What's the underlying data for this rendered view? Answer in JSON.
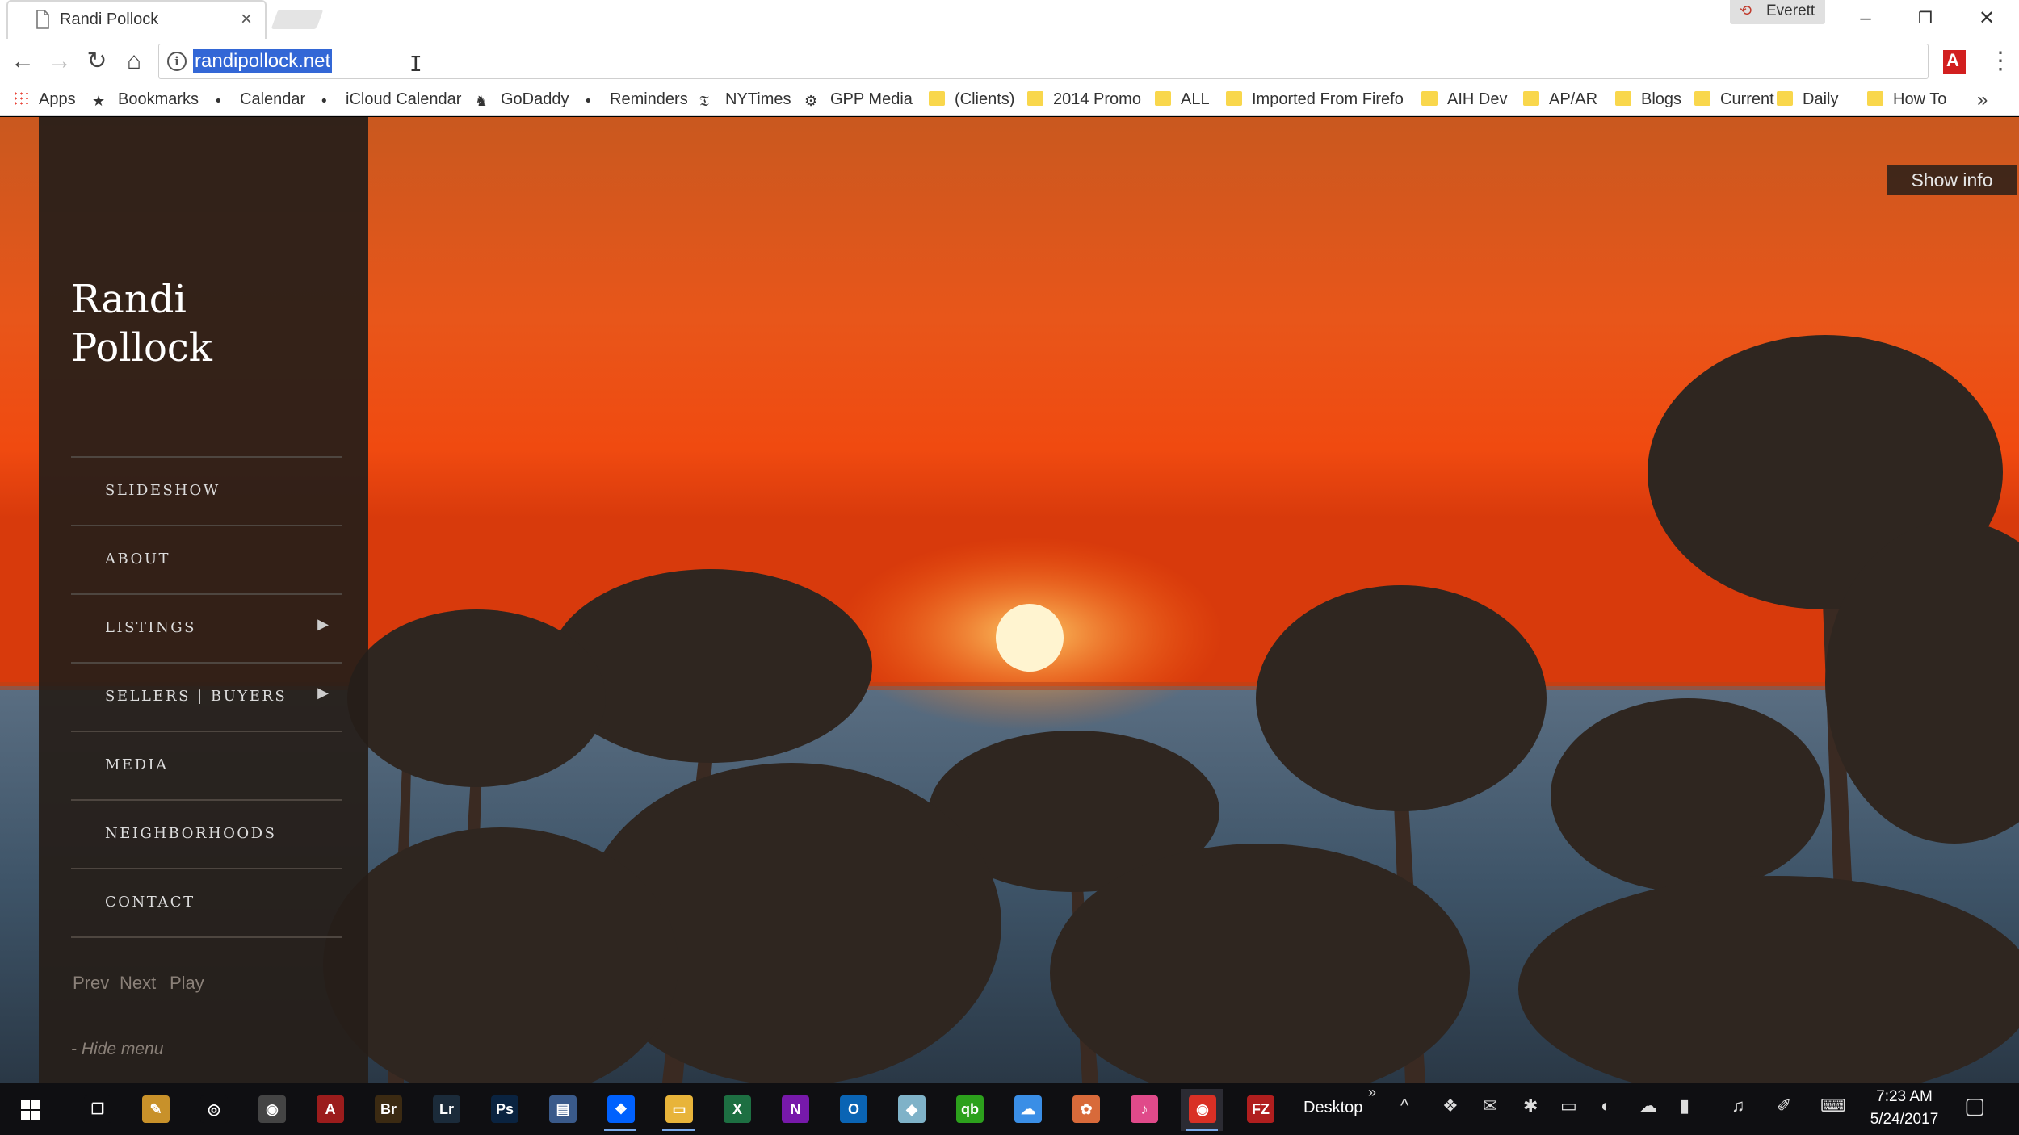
{
  "browser": {
    "tab_title": "Randi Pollock",
    "tab_close": "×",
    "profile_name": "Everett",
    "url": "randipollock.net",
    "window_controls": {
      "minimize": "–",
      "maximize": "❐",
      "close": "✕"
    },
    "nav": {
      "back": "←",
      "forward": "→",
      "reload": "↻",
      "home": "⌂"
    },
    "star": "☆",
    "menu": "⋮",
    "acrobat": "A"
  },
  "bookmarks": [
    {
      "label": "Apps",
      "icon": "apps-grid-icon"
    },
    {
      "label": "Bookmarks",
      "icon": "star-icon"
    },
    {
      "label": "Calendar",
      "icon": "apple-icon"
    },
    {
      "label": "iCloud Calendar",
      "icon": "apple-icon"
    },
    {
      "label": "GoDaddy",
      "icon": "godaddy-icon"
    },
    {
      "label": "Reminders",
      "icon": "apple-icon"
    },
    {
      "label": "NYTimes",
      "icon": "nytimes-icon"
    },
    {
      "label": "GPP Media",
      "icon": "gear-icon"
    },
    {
      "label": "(Clients)",
      "icon": "folder-icon"
    },
    {
      "label": "2014 Promo",
      "icon": "folder-icon"
    },
    {
      "label": "ALL",
      "icon": "folder-icon"
    },
    {
      "label": "Imported From Firefo",
      "icon": "folder-icon"
    },
    {
      "label": "AIH Dev",
      "icon": "folder-icon"
    },
    {
      "label": "AP/AR",
      "icon": "folder-icon"
    },
    {
      "label": "Blogs",
      "icon": "folder-icon"
    },
    {
      "label": "Current",
      "icon": "folder-icon"
    },
    {
      "label": "Daily",
      "icon": "folder-icon"
    },
    {
      "label": "How To",
      "icon": "folder-icon"
    }
  ],
  "bookmarks_more": "»",
  "site": {
    "title_line1": "Randi",
    "title_line2": "Pollock",
    "menu": [
      {
        "label": "SLIDESHOW",
        "submenu": false
      },
      {
        "label": "ABOUT",
        "submenu": false
      },
      {
        "label": "LISTINGS",
        "submenu": true
      },
      {
        "label": "SELLERS | BUYERS",
        "submenu": true
      },
      {
        "label": "MEDIA",
        "submenu": false
      },
      {
        "label": "NEIGHBORHOODS",
        "submenu": false
      },
      {
        "label": "CONTACT",
        "submenu": false
      }
    ],
    "submenu_arrow": "▶",
    "controls": {
      "prev": "Prev",
      "next": "Next",
      "play": "Play"
    },
    "hide_menu": "- Hide menu",
    "show_info": "Show info"
  },
  "taskbar": {
    "start": "start-icon",
    "apps": [
      {
        "name": "task-view-icon",
        "glyph": "❐",
        "color": "#0f0f12"
      },
      {
        "name": "notepad-icon",
        "glyph": "✎",
        "color": "#c8912a"
      },
      {
        "name": "groove-icon",
        "glyph": "◎",
        "color": "#0f0f12"
      },
      {
        "name": "camera-icon",
        "glyph": "◉",
        "color": "#444444"
      },
      {
        "name": "acrobat-icon",
        "glyph": "A",
        "color": "#9b1c1c"
      },
      {
        "name": "bridge-icon",
        "glyph": "Br",
        "color": "#3b2a12"
      },
      {
        "name": "lightroom-icon",
        "glyph": "Lr",
        "color": "#1b2b3a"
      },
      {
        "name": "photoshop-icon",
        "glyph": "Ps",
        "color": "#0a2340"
      },
      {
        "name": "scanner-icon",
        "glyph": "▤",
        "color": "#3a5a8a"
      },
      {
        "name": "dropbox-icon",
        "glyph": "❖",
        "color": "#0061fe"
      },
      {
        "name": "file-explorer-icon",
        "glyph": "▭",
        "color": "#e8b43a"
      },
      {
        "name": "excel-icon",
        "glyph": "X",
        "color": "#1d6f42"
      },
      {
        "name": "onenote-icon",
        "glyph": "N",
        "color": "#7719aa"
      },
      {
        "name": "outlook-icon",
        "glyph": "O",
        "color": "#0a64b4"
      },
      {
        "name": "notes-icon",
        "glyph": "◆",
        "color": "#7fb2c8"
      },
      {
        "name": "quickbooks-icon",
        "glyph": "qb",
        "color": "#2ca01c"
      },
      {
        "name": "icloud-icon",
        "glyph": "☁",
        "color": "#3a8ee6"
      },
      {
        "name": "photos-icon",
        "glyph": "✿",
        "color": "#d86a3a"
      },
      {
        "name": "itunes-icon",
        "glyph": "♪",
        "color": "#e04a8a"
      },
      {
        "name": "chrome-icon",
        "glyph": "◉",
        "color": "#d93025"
      },
      {
        "name": "filezilla-icon",
        "glyph": "FZ",
        "color": "#b01e1e"
      }
    ],
    "desktop_label": "Desktop",
    "desktop_chevron": "»",
    "tray": [
      {
        "name": "show-hidden-icons-icon",
        "glyph": "^"
      },
      {
        "name": "dropbox-tray-icon",
        "glyph": "❖"
      },
      {
        "name": "outlook-tray-icon",
        "glyph": "✉"
      },
      {
        "name": "bluetooth-icon",
        "glyph": "✱"
      },
      {
        "name": "network-icon",
        "glyph": "▭"
      },
      {
        "name": "sync-tray-icon",
        "glyph": "◐"
      },
      {
        "name": "cloud-tray-icon",
        "glyph": "☁"
      },
      {
        "name": "battery-icon",
        "glyph": "▮"
      },
      {
        "name": "volume-icon",
        "glyph": "♫"
      },
      {
        "name": "pen-icon",
        "glyph": "✐"
      },
      {
        "name": "keyboard-icon",
        "glyph": "⌨"
      }
    ],
    "time": "7:23 AM",
    "date": "5/24/2017",
    "notifications": "▢"
  }
}
